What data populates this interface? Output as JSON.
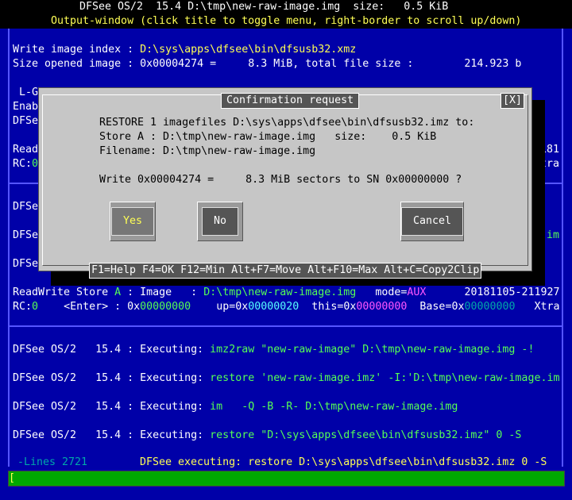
{
  "title": {
    "line1": "DFSee OS/2  15.4 D:\\tmp\\new-raw-image.img  size:   0.5 KiB",
    "line2": "Output-window (click title to toggle menu, right-border to scroll up/down)"
  },
  "output": {
    "l1_label": "Write image index : ",
    "l1_value": "D:\\sys\\apps\\dfsee\\bin\\dfsusb32.xmz",
    "l2": "Size opened image : 0x00004274 =     8.3 MiB, total file size :        214.923 b",
    "l3": " L-G",
    "l4": "Enab",
    "l5": "DFSe",
    "l6": "Read",
    "l6r": "0181",
    "l7": "RC:",
    "l7g": "0",
    "l7r": "Xtra",
    "l8": "DFSe",
    "l9": "DFSe",
    "l9r": "e.im",
    "l10": "DFSe",
    "rw_prefix": "ReadWrite Store ",
    "rw_store": "A",
    "rw_mid": " : Image   : ",
    "rw_file": "D:\\tmp\\new-raw-image.img",
    "rw_mode": "   mode=",
    "rw_aux": "AUX",
    "rw_date": "      20181105-211927",
    "rc_label": "RC:",
    "rc_val": "0",
    "rc_enter": "    <Enter> : 0x",
    "rc_hex1": "00000000",
    "rc_up": "    up=0x",
    "rc_hex2": "00000020",
    "rc_this": "  this=0x",
    "rc_hex3": "00000000",
    "rc_base": "  Base=0x",
    "rc_hex4": "00000000",
    "rc_xtra": "   Xtra",
    "exec": [
      {
        "prefix": "DFSee OS/2   15.4 : Executing: ",
        "cmd": "imz2raw \"new-raw-image\" D:\\tmp\\new-raw-image.img -!"
      },
      {
        "prefix": "DFSee OS/2   15.4 : Executing: ",
        "cmd": "restore 'new-raw-image.imz' -I:'D:\\tmp\\new-raw-image.im"
      },
      {
        "prefix": "DFSee OS/2   15.4 : Executing: ",
        "cmd": "im   -Q -B -R- D:\\tmp\\new-raw-image.img"
      },
      {
        "prefix": "DFSee OS/2   15.4 : Executing: ",
        "cmd": "restore \"D:\\sys\\apps\\dfsee\\bin\\dfsusb32.imz\" 0 -S"
      }
    ]
  },
  "dialog": {
    "title": "Confirmation request",
    "close": "[X]",
    "line1": "RESTORE 1 imagefiles D:\\sys\\apps\\dfsee\\bin\\dfsusb32.imz to:",
    "line2": "Store A : D:\\tmp\\new-raw-image.img   size:    0.5 KiB",
    "line3": "Filename: D:\\tmp\\new-raw-image.img",
    "line4": "Write 0x00004274 =     8.3 MiB sectors to SN 0x00000000 ?",
    "yes": "Yes",
    "no": "No",
    "cancel": "Cancel",
    "footer": "F1=Help F4=OK F12=Min Alt+F7=Move Alt+F10=Max Alt+C=Copy2Clip"
  },
  "status": {
    "lines": "-Lines 2721",
    "executing": "DFSee executing: restore D:\\sys\\apps\\dfsee\\bin\\dfsusb32.imz 0 -S"
  },
  "cmdline": {
    "text": "["
  }
}
